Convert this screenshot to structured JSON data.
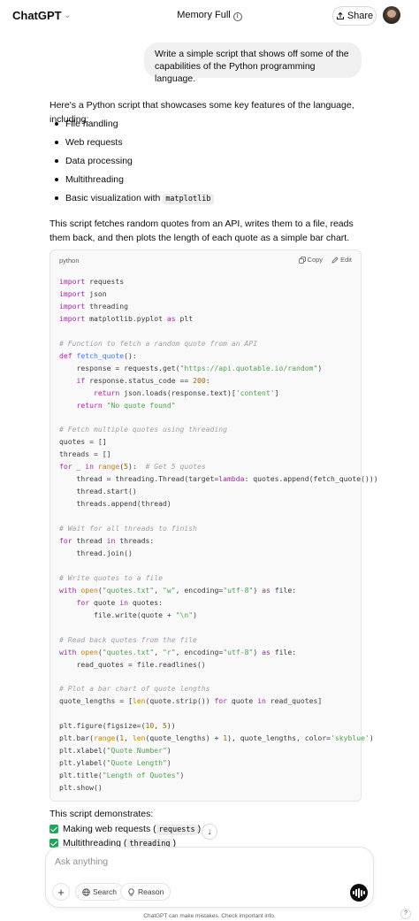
{
  "header": {
    "brand": "ChatGPT",
    "memory": "Memory Full",
    "share_label": "Share"
  },
  "user_message": "Write a simple script that shows off some of the capabilities of the Python programming language.",
  "assistant": {
    "intro": "Here's a Python script that showcases some key features of the language, including:",
    "bullets": [
      "File handling",
      "Web requests",
      "Data processing",
      "Multithreading",
      "Basic visualization with"
    ],
    "bullet_code": "matplotlib",
    "summary": "This script fetches random quotes from an API, writes them to a file, reads them back, and then plots the length of each quote as a simple bar chart.",
    "code_block": {
      "language": "python",
      "copy_label": "Copy",
      "edit_label": "Edit",
      "lines": [
        "import requests",
        "import json",
        "import threading",
        "import matplotlib.pyplot as plt",
        "",
        "# Function to fetch a random quote from an API",
        "def fetch_quote():",
        "    response = requests.get(\"https://api.quotable.io/random\")",
        "    if response.status_code == 200:",
        "        return json.loads(response.text)['content']",
        "    return \"No quote found\"",
        "",
        "# Fetch multiple quotes using threading",
        "quotes = []",
        "threads = []",
        "for _ in range(5):  # Get 5 quotes",
        "    thread = threading.Thread(target=lambda: quotes.append(fetch_quote()))",
        "    thread.start()",
        "    threads.append(thread)",
        "",
        "# Wait for all threads to finish",
        "for thread in threads:",
        "    thread.join()",
        "",
        "# Write quotes to a file",
        "with open(\"quotes.txt\", \"w\", encoding=\"utf-8\") as file:",
        "    for quote in quotes:",
        "        file.write(quote + \"\\n\")",
        "",
        "# Read back quotes from the file",
        "with open(\"quotes.txt\", \"r\", encoding=\"utf-8\") as file:",
        "    read_quotes = file.readlines()",
        "",
        "# Plot a bar chart of quote lengths",
        "quote_lengths = [len(quote.strip()) for quote in read_quotes]",
        "",
        "plt.figure(figsize=(10, 5))",
        "plt.bar(range(1, len(quote_lengths) + 1), quote_lengths, color='skyblue')",
        "plt.xlabel(\"Quote Number\")",
        "plt.ylabel(\"Quote Length\")",
        "plt.title(\"Length of Quotes\")",
        "plt.show()"
      ]
    },
    "demonstrates": "This script demonstrates:",
    "checks": [
      {
        "label": "Making web requests (",
        "code": "requests",
        "tail": ")"
      },
      {
        "label": "Multithreading (",
        "code": "threading",
        "tail": ")"
      }
    ]
  },
  "composer": {
    "placeholder": "Ask anything",
    "search_label": "Search",
    "reason_label": "Reason"
  },
  "footer": "ChatGPT can make mistakes. Check important info.",
  "help": "?"
}
